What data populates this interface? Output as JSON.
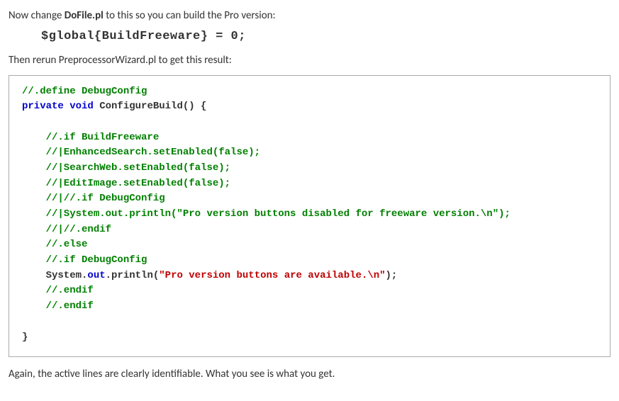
{
  "intro": {
    "prefix": "Now change ",
    "filename": "DoFile.pl",
    "suffix": " to this so you can build the Pro version:"
  },
  "globalLine": "$global{BuildFreeware} = 0;",
  "rerun": "Then rerun PreprocessorWizard.pl to get this result:",
  "code": {
    "l1": "//.define DebugConfig",
    "l2a": "private",
    "l2b": " ",
    "l2c": "void",
    "l2d": " ConfigureBuild() {",
    "l3": "    //.if BuildFreeware",
    "l4": "    //|EnhancedSearch.setEnabled(false);",
    "l5": "    //|SearchWeb.setEnabled(false);",
    "l6": "    //|EditImage.setEnabled(false);",
    "l7": "    //|//.if DebugConfig",
    "l8": "    //|System.out.println(\"Pro version buttons disabled for freeware version.\\n\");",
    "l9": "    //|//.endif",
    "l10": "    //.else",
    "l11": "    //.if DebugConfig",
    "l12a": "    System.",
    "l12b": "out",
    "l12c": ".println(",
    "l12d": "\"Pro version buttons are available.\\n\"",
    "l12e": ");",
    "l13": "    //.endif",
    "l14": "    //.endif",
    "l15": "}"
  },
  "closing": "Again, the active lines are clearly identifiable.  What you see is what you get."
}
